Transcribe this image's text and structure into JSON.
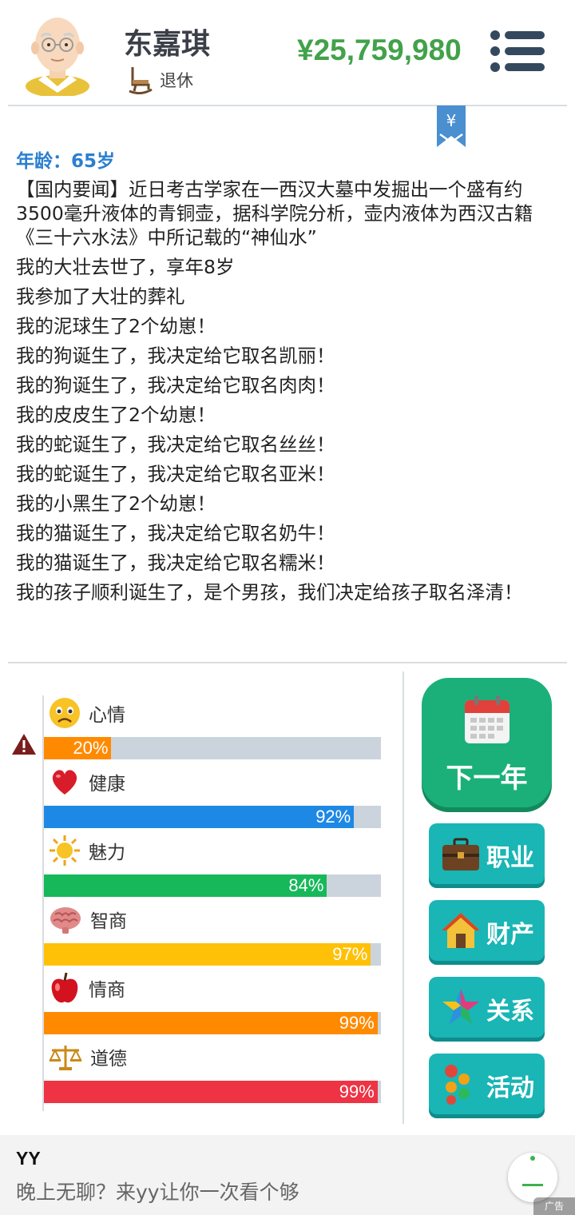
{
  "profile": {
    "name": "东嘉琪",
    "status": "退休",
    "money": "¥25,759,980"
  },
  "bookmark_symbol": "¥",
  "log": {
    "age": "年龄：65岁",
    "lines": [
      "【国内要闻】近日考古学家在一西汉大墓中发掘出一个盛有约3500毫升液体的青铜壶，据科学院分析，壶内液体为西汉古籍《三十六水法》中所记载的“神仙水”",
      "我的大壮去世了，享年8岁",
      "我参加了大壮的葬礼",
      "我的泥球生了2个幼崽！",
      "我的狗诞生了，我决定给它取名凯丽！",
      "我的狗诞生了，我决定给它取名肉肉！",
      "我的皮皮生了2个幼崽！",
      "我的蛇诞生了，我决定给它取名丝丝！",
      "我的蛇诞生了，我决定给它取名亚米！",
      "我的小黑生了2个幼崽！",
      "我的猫诞生了，我决定给它取名奶牛！",
      "我的猫诞生了，我决定给它取名糯米！",
      "我的孩子顺利诞生了，是个男孩，我们决定给孩子取名泽清！"
    ]
  },
  "stats": [
    {
      "label": "心情",
      "value": 20,
      "text": "20%",
      "color": "#ff8a00",
      "icon": "sad-face-icon"
    },
    {
      "label": "健康",
      "value": 92,
      "text": "92%",
      "color": "#1e88e5",
      "icon": "heart-icon"
    },
    {
      "label": "魅力",
      "value": 84,
      "text": "84%",
      "color": "#16b85a",
      "icon": "sun-icon"
    },
    {
      "label": "智商",
      "value": 97,
      "text": "97%",
      "color": "#ffc107",
      "icon": "brain-icon"
    },
    {
      "label": "情商",
      "value": 99,
      "text": "99%",
      "color": "#ff8a00",
      "icon": "apple-icon"
    },
    {
      "label": "道德",
      "value": 99,
      "text": "99%",
      "color": "#ee3344",
      "icon": "scales-icon"
    }
  ],
  "buttons": {
    "next_year": "下一年",
    "career": "职业",
    "property": "财产",
    "relations": "关系",
    "activities": "活动"
  },
  "ad": {
    "title": "YY",
    "text": "晚上无聊？来yy让你一次看个够",
    "tag": "广告"
  }
}
